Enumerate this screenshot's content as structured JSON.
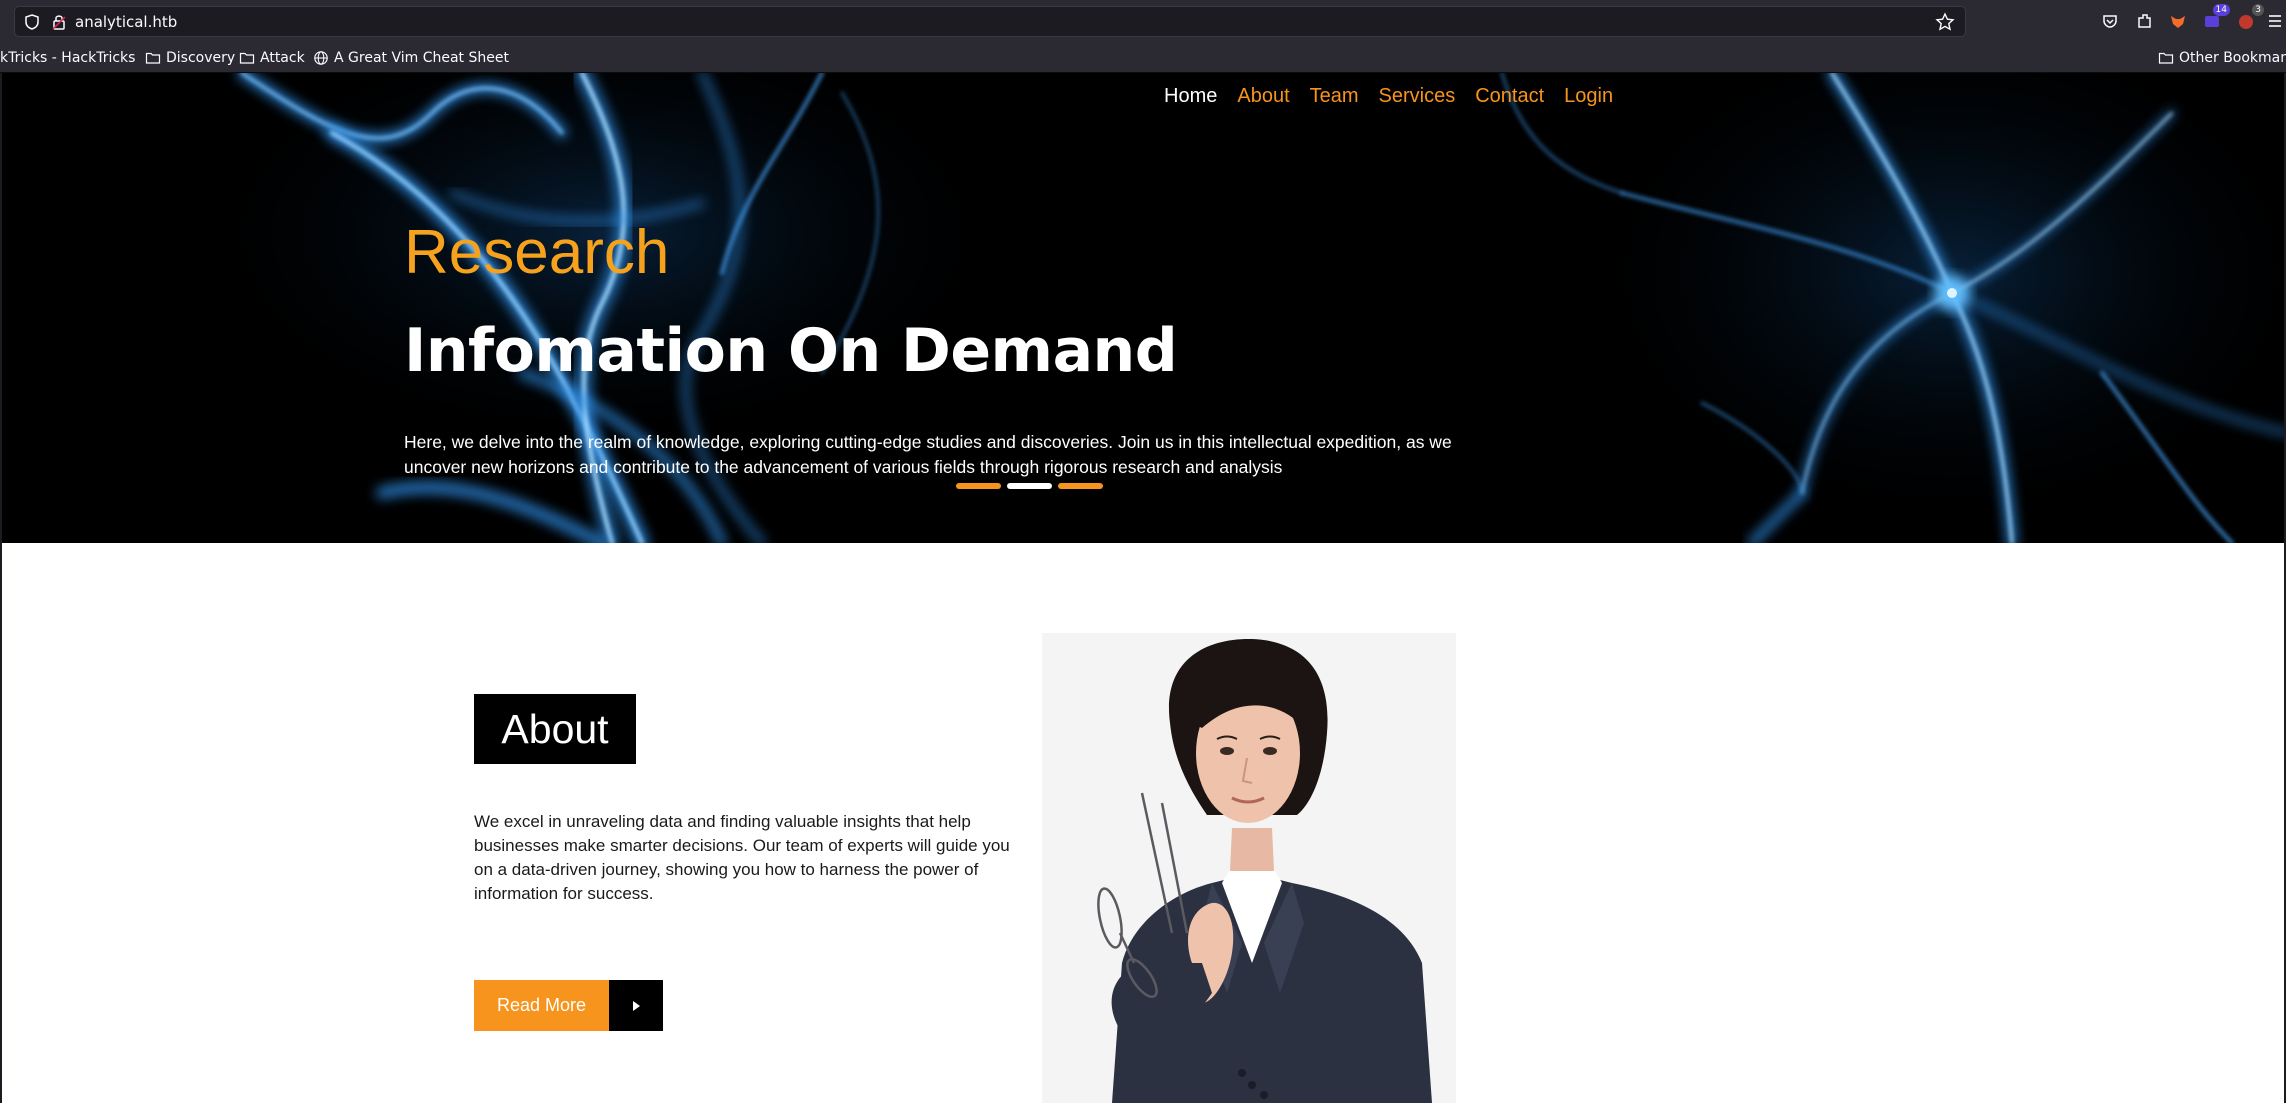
{
  "browser": {
    "url": "analytical.htb",
    "toolbar_badges": {
      "extension_badge_1": "14",
      "extension_badge_2": "3"
    },
    "bookmarks": [
      {
        "label": "kTricks - HackTricks",
        "icon": "globe-icon"
      },
      {
        "label": "Discovery",
        "icon": "folder-icon"
      },
      {
        "label": "Attack",
        "icon": "folder-icon"
      },
      {
        "label": "A Great Vim Cheat Sheet",
        "icon": "globe-icon"
      }
    ],
    "other_bookmarks": "Other Bookmarks"
  },
  "nav": {
    "items": [
      {
        "label": "Home",
        "active": true
      },
      {
        "label": "About"
      },
      {
        "label": "Team"
      },
      {
        "label": "Services"
      },
      {
        "label": "Contact"
      },
      {
        "label": "Login"
      }
    ]
  },
  "hero": {
    "eyebrow": "Research",
    "title": "Infomation On Demand",
    "text": "Here, we delve into the realm of knowledge, exploring cutting-edge studies and discoveries. Join us in this intellectual expedition, as we uncover new horizons and contribute to the advancement of various fields through rigorous research and analysis",
    "slide_count": 3,
    "active_slide": 2
  },
  "about": {
    "heading": "About",
    "text": "We excel in unraveling data and finding valuable insights that help businesses make smarter decisions. Our team of experts will guide you on a data-driven journey, showing you how to harness the power of information for success.",
    "button_label": "Read More"
  },
  "colors": {
    "accent": "#f7941d",
    "hero_bg": "#000000",
    "chrome_bg": "#2b2a33"
  }
}
